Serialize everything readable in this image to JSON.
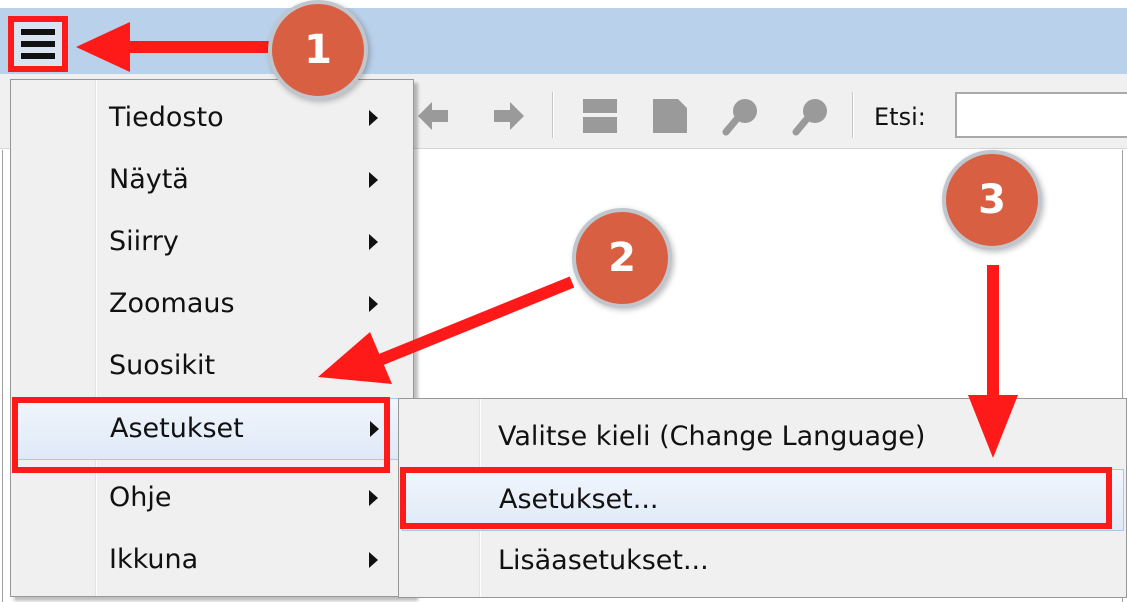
{
  "toolbar": {
    "search_label": "Etsi:",
    "search_value": ""
  },
  "main_menu": {
    "items": [
      {
        "label": "Tiedosto",
        "has_submenu": true
      },
      {
        "label": "Näytä",
        "has_submenu": true
      },
      {
        "label": "Siirry",
        "has_submenu": true
      },
      {
        "label": "Zoomaus",
        "has_submenu": true
      },
      {
        "label": "Suosikit",
        "has_submenu": false
      },
      {
        "label": "Asetukset",
        "has_submenu": true,
        "highlighted": true
      },
      {
        "label": "Ohje",
        "has_submenu": true
      },
      {
        "label": "Ikkuna",
        "has_submenu": true
      }
    ]
  },
  "sub_menu": {
    "items": [
      {
        "label": "Valitse kieli (Change Language)"
      },
      {
        "label": "Asetukset...",
        "highlighted": true
      },
      {
        "label": "Lisäasetukset..."
      }
    ]
  },
  "annotations": {
    "step_1": "1",
    "step_2": "2",
    "step_3": "3",
    "highlight_color": "#ff1a1a",
    "badge_color": "#d95f43"
  },
  "icons": {
    "menu_button": "hamburger-icon",
    "toolbar": [
      "back-arrow-icon",
      "forward-arrow-icon",
      "fit-page-icon",
      "fit-width-icon",
      "zoom-in-icon",
      "zoom-out-icon"
    ],
    "submenu_arrow": "submenu-arrow-icon"
  }
}
